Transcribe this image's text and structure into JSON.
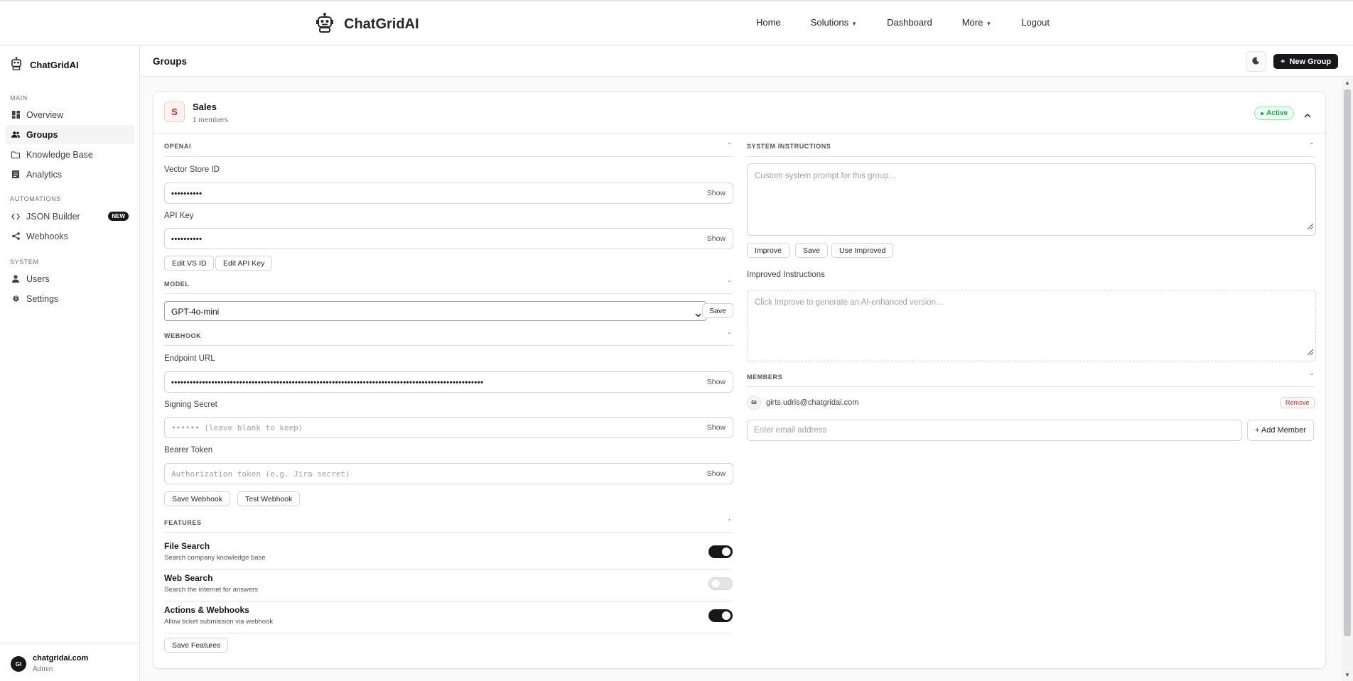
{
  "topnav": {
    "brand": "ChatGridAI",
    "menu": [
      {
        "label": "Home",
        "caret": false
      },
      {
        "label": "Solutions",
        "caret": true
      },
      {
        "label": "Dashboard",
        "caret": false
      },
      {
        "label": "More",
        "caret": true
      },
      {
        "label": "Logout",
        "caret": false
      }
    ]
  },
  "sidebar": {
    "brand": "ChatGridAI",
    "sections": {
      "main": "MAIN",
      "automations": "AUTOMATIONS",
      "system": "SYSTEM"
    },
    "items": {
      "overview": "Overview",
      "groups": "Groups",
      "knowledge": "Knowledge Base",
      "analytics": "Analytics",
      "json_builder": "JSON Builder",
      "json_badge": "NEW",
      "webhooks": "Webhooks",
      "users": "Users",
      "settings": "Settings"
    },
    "user": {
      "initials": "GI",
      "name": "chatgridai.com",
      "role": "Admin"
    }
  },
  "page": {
    "title": "Groups",
    "new_group": "New Group"
  },
  "group": {
    "initial": "S",
    "name": "Sales",
    "members_count": "1 members",
    "status": "Active",
    "openai": {
      "section": "OPENAI",
      "vector_label": "Vector Store ID",
      "vector_value": "••••••••••",
      "api_label": "API Key",
      "api_value": "••••••••••",
      "show": "Show",
      "edit_vs": "Edit VS ID",
      "edit_api": "Edit API Key"
    },
    "model": {
      "section": "MODEL",
      "selected": "GPT-4o-mini",
      "save": "Save"
    },
    "webhook": {
      "section": "WEBHOOK",
      "endpoint_label": "Endpoint URL",
      "endpoint_value": "•••••••••••••••••••••••••••••••••••••••••••••••••••••••••••••••••••••••••••••••••••••••••••••••••••••",
      "secret_label": "Signing Secret",
      "secret_placeholder": "•••••• (leave blank to keep)",
      "bearer_label": "Bearer Token",
      "bearer_placeholder": "Authorization token (e.g. Jira secret)",
      "show": "Show",
      "save": "Save Webhook",
      "test": "Test Webhook"
    },
    "features": {
      "section": "FEATURES",
      "items": [
        {
          "title": "File Search",
          "desc": "Search company knowledge base",
          "on": true
        },
        {
          "title": "Web Search",
          "desc": "Search the internet for answers",
          "on": false
        },
        {
          "title": "Actions & Webhooks",
          "desc": "Allow ticket submission via webhook",
          "on": true
        }
      ],
      "save": "Save Features"
    },
    "instructions": {
      "section": "SYSTEM INSTRUCTIONS",
      "placeholder": "Custom system prompt for this group...",
      "improve": "Improve",
      "save": "Save",
      "use_improved": "Use Improved",
      "improved_label": "Improved Instructions",
      "improved_placeholder": "Click Improve to generate an AI-enhanced version..."
    },
    "members": {
      "section": "MEMBERS",
      "list": [
        {
          "initials": "GI",
          "email": "girts.udris@chatgridai.com",
          "remove": "Remove"
        }
      ],
      "email_placeholder": "Enter email address",
      "add": "+ Add Member"
    }
  }
}
